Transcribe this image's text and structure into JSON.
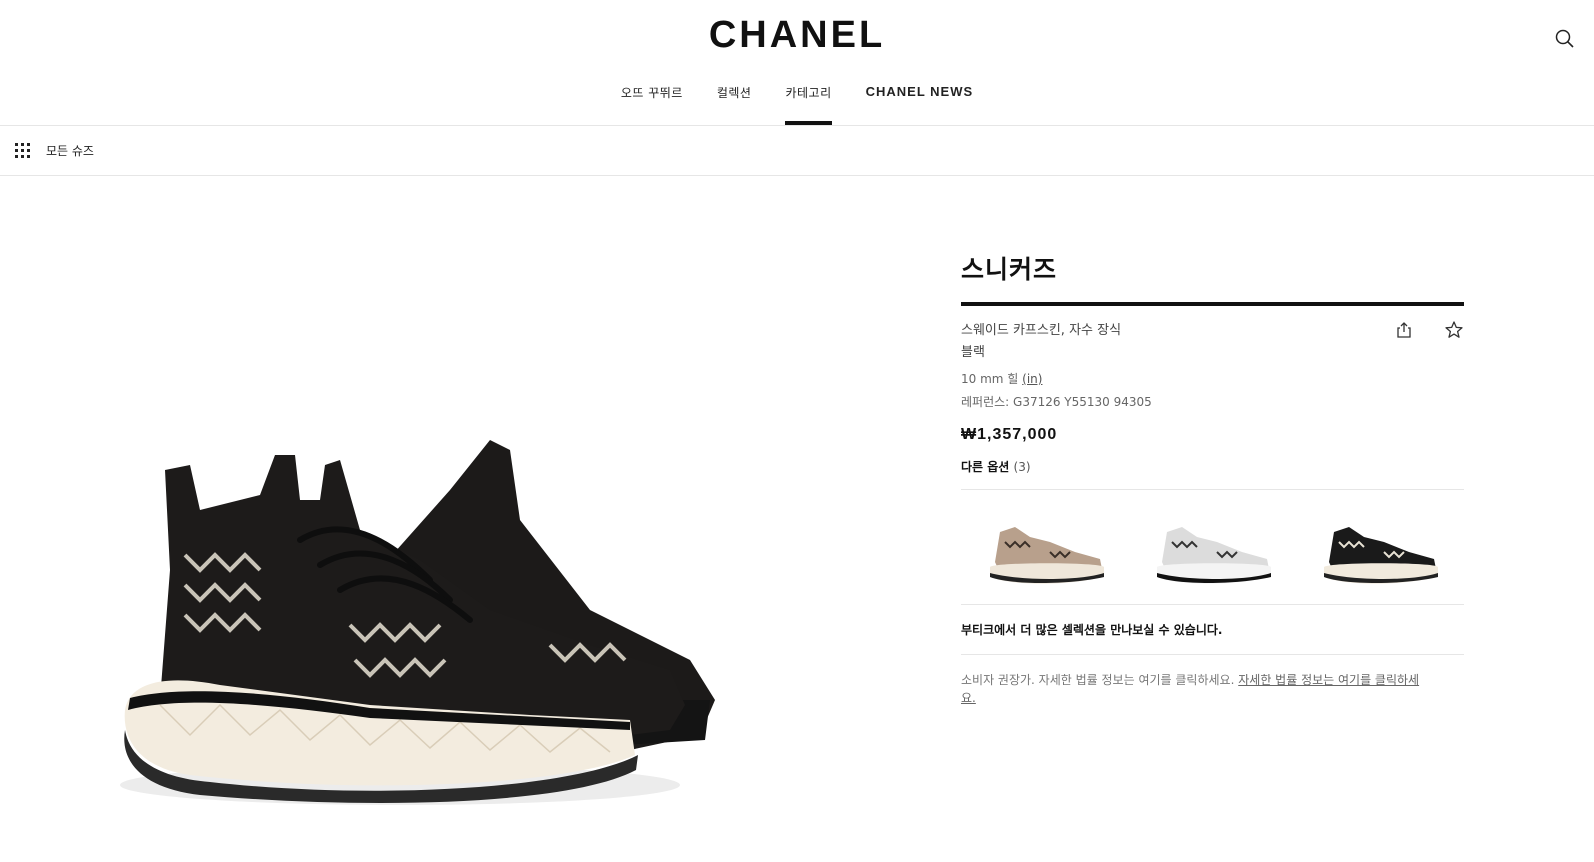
{
  "header": {
    "logo": "CHANEL",
    "nav": [
      {
        "label": "오뜨 꾸뛰르"
      },
      {
        "label": "컬렉션"
      },
      {
        "label": "카테고리"
      },
      {
        "label": "CHANEL NEWS"
      }
    ],
    "active_nav": "카테고리"
  },
  "subbar": {
    "label": "모든 슈즈"
  },
  "product": {
    "title": "스니커즈",
    "material": "스웨이드 카프스킨, 자수 장식",
    "color": "블랙",
    "heel": "10 mm 힐",
    "heel_unit_link": "(in)",
    "reference": "레퍼런스: G37126 Y55130 94305",
    "price": "₩1,357,000",
    "other_options_label": "다른 옵션",
    "other_options_count": "(3)",
    "options": [
      {
        "color": "#b8a08c",
        "name": "beige-option"
      },
      {
        "color": "#d9d9d9",
        "name": "white-option"
      },
      {
        "color": "#1a1a1a",
        "name": "black-option"
      }
    ],
    "boutique_text": "부티크에서 더 많은 셀렉션을 만나보실 수 있습니다.",
    "legal_text": "소비자 권장가. 자세한 법률 정보는 여기를 클릭하세요.",
    "legal_link": "자세한 법률 정보는 여기를 클릭하세요."
  },
  "icons": {
    "search": "search-icon",
    "grid": "grid-icon",
    "share": "share-icon",
    "wishlist": "star-icon"
  }
}
